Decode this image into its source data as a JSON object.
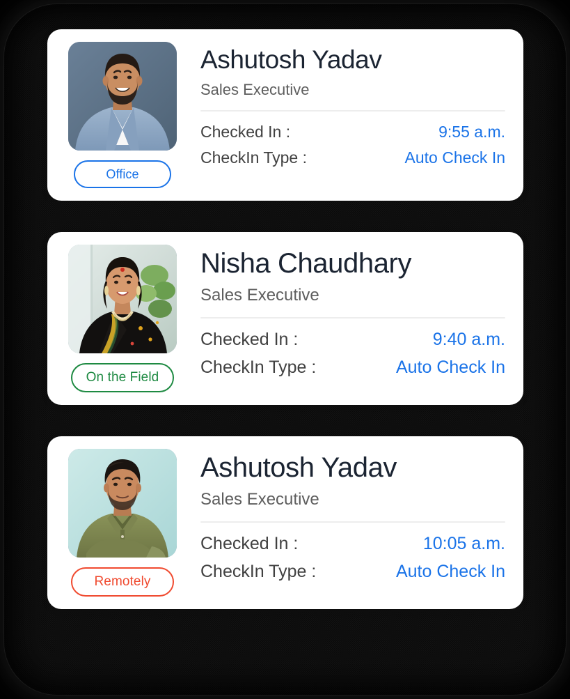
{
  "colors": {
    "accent_blue": "#1a73e8",
    "badge_blue": "#1a73e8",
    "badge_green": "#1e8a42",
    "badge_red": "#f04a2f",
    "name_text": "#1b2432",
    "role_text": "#5e5e5e",
    "label_text": "#414141",
    "card_bg": "#ffffff",
    "page_bg": "#000000",
    "divider": "#ededed"
  },
  "labels": {
    "checked_in": "Checked In :",
    "checkin_type": "CheckIn Type :"
  },
  "cards": [
    {
      "name": "Ashutosh Yadav",
      "role": "Sales Executive",
      "badge": {
        "text": "Office",
        "style": "blue"
      },
      "checked_in_label": "Checked In :",
      "checked_in_value": "9:55 a.m.",
      "checkin_type_label": "CheckIn Type :",
      "checkin_type_value": "Auto Check In",
      "avatar": {
        "name": "avatar-ashutosh-yadav-blazer",
        "bg": "#5d7389",
        "skin": "#c98e62",
        "hair": "#241a14",
        "garment": "#8fa9c4",
        "garment_dark": "#6f8bab",
        "shirt": "#f5f5f5"
      }
    },
    {
      "name": "Nisha Chaudhary",
      "role": "Sales Executive",
      "badge": {
        "text": "On the Field",
        "style": "green"
      },
      "checked_in_label": "Checked In :",
      "checked_in_value": "9:40 a.m.",
      "checkin_type_label": "CheckIn Type :",
      "checkin_type_value": "Auto Check In",
      "avatar": {
        "name": "avatar-nisha-chaudhary-saree",
        "bg": "#cfdbd6",
        "skin": "#d79a6e",
        "hair": "#17110c",
        "garment": "#12100f",
        "garment_dark": "#000000",
        "shirt": "#e9e2c9"
      }
    },
    {
      "name": "Ashutosh Yadav",
      "role": "Sales Executive",
      "badge": {
        "text": "Remotely",
        "style": "red"
      },
      "checked_in_label": "Checked In :",
      "checked_in_value": "10:05 a.m.",
      "checkin_type_label": "CheckIn Type :",
      "checkin_type_value": "Auto Check In",
      "avatar": {
        "name": "avatar-ashutosh-yadav-olive-shirt",
        "bg": "#bfe0e0",
        "skin": "#c98a5f",
        "hair": "#1a1410",
        "garment": "#7e8650",
        "garment_dark": "#656c3d",
        "shirt": "#7e8650"
      }
    }
  ]
}
